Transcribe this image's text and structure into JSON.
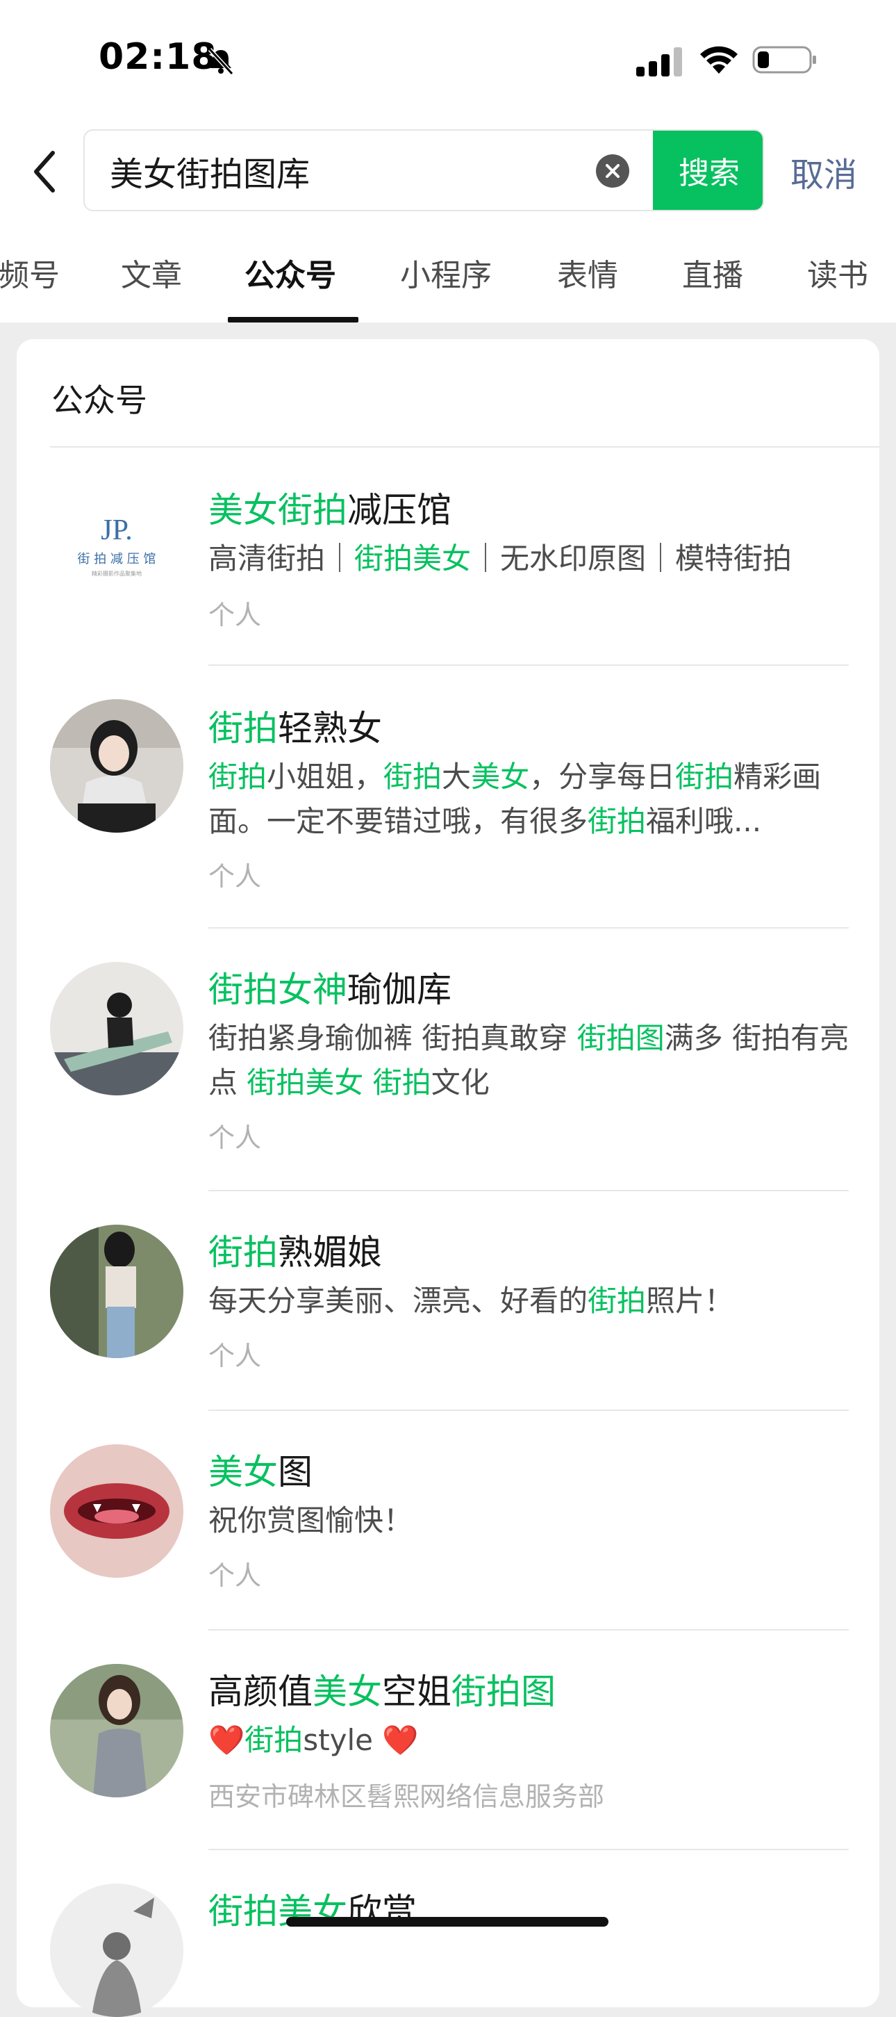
{
  "status_bar": {
    "time": "02:18",
    "icons": [
      "bell-muted-icon",
      "cellular-signal-icon",
      "wifi-icon",
      "battery-icon"
    ]
  },
  "search": {
    "query": "美女街拍图库",
    "search_label": "搜索",
    "cancel_label": "取消"
  },
  "tabs": [
    {
      "label": "频号"
    },
    {
      "label": "文章"
    },
    {
      "label": "公众号"
    },
    {
      "label": "小程序"
    },
    {
      "label": "表情"
    },
    {
      "label": "直播"
    },
    {
      "label": "读书"
    }
  ],
  "active_tab": "公众号",
  "section_title": "公众号",
  "results": [
    {
      "name": [
        {
          "t": "美女街拍",
          "h": true
        },
        {
          "t": "减压馆",
          "h": false
        }
      ],
      "desc": [
        {
          "t": "高清街拍｜",
          "h": false
        },
        {
          "t": "街拍美女",
          "h": true
        },
        {
          "t": "｜无水印原图｜模特街拍",
          "h": false
        }
      ],
      "meta": "个人",
      "avatar_logo_text": "JP.",
      "avatar_logo_sub": "街 拍 减 压 馆",
      "avatar_logo_tiny": "精彩摄影作品聚集地"
    },
    {
      "name": [
        {
          "t": "街拍",
          "h": true
        },
        {
          "t": "轻熟女",
          "h": false
        }
      ],
      "desc": [
        {
          "t": "街拍",
          "h": true
        },
        {
          "t": "小姐姐，",
          "h": false
        },
        {
          "t": "街拍",
          "h": true
        },
        {
          "t": "大",
          "h": false
        },
        {
          "t": "美女",
          "h": true
        },
        {
          "t": "，分享每日",
          "h": false
        },
        {
          "t": "街拍",
          "h": true
        },
        {
          "t": "精彩画面。一定不要错过哦，有很多",
          "h": false
        },
        {
          "t": "街拍",
          "h": true
        },
        {
          "t": "福利哦...",
          "h": false
        }
      ],
      "meta": "个人"
    },
    {
      "name": [
        {
          "t": "街拍女神",
          "h": true
        },
        {
          "t": "瑜伽库",
          "h": false
        }
      ],
      "desc": [
        {
          "t": "街拍紧身瑜伽裤 街拍真敢穿 ",
          "h": false
        },
        {
          "t": "街拍图",
          "h": true
        },
        {
          "t": "满多 街拍有亮点 ",
          "h": false
        },
        {
          "t": "街拍美女",
          "h": true
        },
        {
          "t": " ",
          "h": false
        },
        {
          "t": "街拍",
          "h": true
        },
        {
          "t": "文化",
          "h": false
        }
      ],
      "meta": "个人"
    },
    {
      "name": [
        {
          "t": "街拍",
          "h": true
        },
        {
          "t": "熟媚娘",
          "h": false
        }
      ],
      "desc": [
        {
          "t": "每天分享美丽、漂亮、好看的",
          "h": false
        },
        {
          "t": "街拍",
          "h": true
        },
        {
          "t": "照片！",
          "h": false
        }
      ],
      "meta": "个人"
    },
    {
      "name": [
        {
          "t": "美女",
          "h": true
        },
        {
          "t": "图",
          "h": false
        }
      ],
      "desc": [
        {
          "t": "祝你赏图愉快！",
          "h": false
        }
      ],
      "meta": "个人"
    },
    {
      "name": [
        {
          "t": "高颜值",
          "h": false
        },
        {
          "t": "美女",
          "h": true
        },
        {
          "t": "空姐",
          "h": false
        },
        {
          "t": "街拍图",
          "h": true
        }
      ],
      "desc": [
        {
          "t": "❤️",
          "h": false
        },
        {
          "t": "街拍",
          "h": true
        },
        {
          "t": "style ❤️",
          "h": false
        }
      ],
      "meta": "西安市碑林区髫熙网络信息服务部"
    },
    {
      "name": [
        {
          "t": "街拍美女",
          "h": true
        },
        {
          "t": "欣赏",
          "h": false
        }
      ],
      "desc": [],
      "meta": ""
    }
  ],
  "colors": {
    "accent_green": "#07C160",
    "link_blue": "#576B95",
    "background": "#EDEDED"
  }
}
